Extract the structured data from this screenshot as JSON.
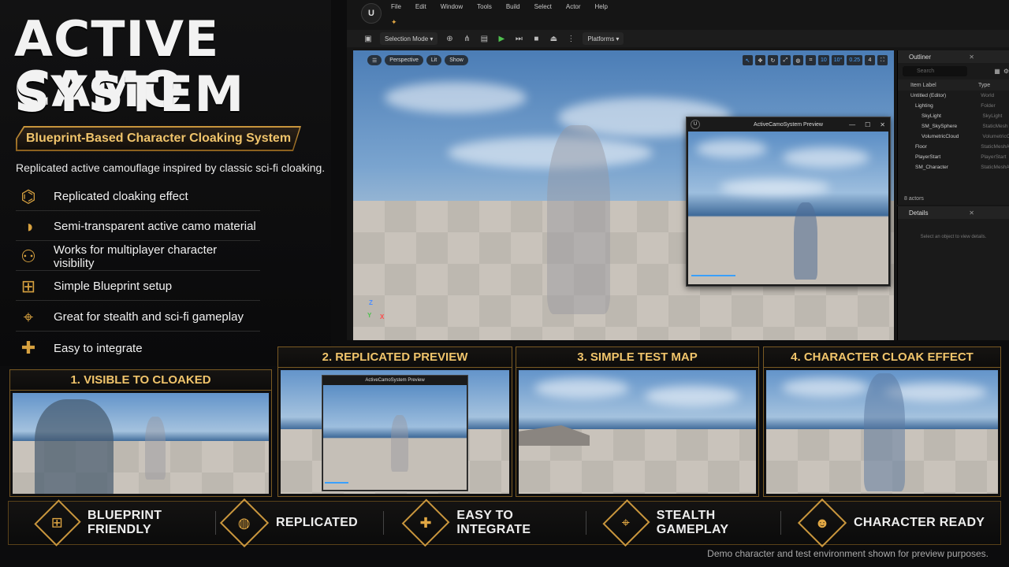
{
  "left": {
    "title_line1": "ACTIVE CAMO",
    "title_line2": "SYSTEM",
    "subtitle": "Blueprint-Based Character Cloaking System",
    "tagline": "Replicated active camouflage inspired by classic sci-fi cloaking.",
    "features": [
      {
        "icon": "network-nodes-icon",
        "glyph": "⌬",
        "label": "Replicated cloaking effect"
      },
      {
        "icon": "half-circle-icon",
        "glyph": "◑",
        "label": "Semi-transparent active camo material"
      },
      {
        "icon": "group-users-icon",
        "glyph": "⚇",
        "label": "Works for multiplayer character visibility"
      },
      {
        "icon": "hierarchy-icon",
        "glyph": "⊞",
        "label": "Simple Blueprint setup"
      },
      {
        "icon": "crosshair-icon",
        "glyph": "⌖",
        "label": "Great for stealth and sci-fi gameplay"
      },
      {
        "icon": "puzzle-icon",
        "glyph": "✚",
        "label": "Easy to integrate"
      }
    ]
  },
  "editor": {
    "menu": [
      "File",
      "Edit",
      "Window",
      "Tools",
      "Build",
      "Select",
      "Actor",
      "Help"
    ],
    "toolbar": {
      "mode": "Selection Mode",
      "platforms": "Platforms"
    },
    "viewport": {
      "perspective": "Perspective",
      "lit": "Lit",
      "show": "Show",
      "grid_snap": "10",
      "rot_snap": "10°",
      "scale_snap": "0.25",
      "cam_speed": "4"
    },
    "preview_title": "ActiveCamoSystem Preview",
    "outliner": {
      "title": "Outliner",
      "search_placeholder": "Search",
      "col_label": "Item Label",
      "col_type": "Type",
      "rows": [
        {
          "name": "Untitled (Editor)",
          "type": "World"
        },
        {
          "name": "Lighting",
          "type": "Folder"
        },
        {
          "name": "SkyLight",
          "type": "SkyLight"
        },
        {
          "name": "SM_SkySphere",
          "type": "StaticMesh"
        },
        {
          "name": "VolumetricCloud",
          "type": "VolumetricClo"
        },
        {
          "name": "Floor",
          "type": "StaticMeshAct"
        },
        {
          "name": "PlayerStart",
          "type": "PlayerStart"
        },
        {
          "name": "SM_Character",
          "type": "StaticMeshAct"
        }
      ],
      "count": "8 actors"
    },
    "details": {
      "title": "Details",
      "hint": "Select an object to view details."
    }
  },
  "cards": [
    {
      "title": "1. VISIBLE TO CLOAKED"
    },
    {
      "title": "2. REPLICATED PREVIEW",
      "inner_title": "ActiveCamoSystem Preview"
    },
    {
      "title": "3. SIMPLE TEST MAP"
    },
    {
      "title": "4. CHARACTER CLOAK EFFECT"
    }
  ],
  "bottom": [
    {
      "icon": "blueprint-icon",
      "glyph": "⊞",
      "label": "BLUEPRINT FRIENDLY"
    },
    {
      "icon": "globe-icon",
      "glyph": "◍",
      "label": "REPLICATED"
    },
    {
      "icon": "puzzle-icon",
      "glyph": "✚",
      "label": "EASY TO INTEGRATE"
    },
    {
      "icon": "crosshair-icon",
      "glyph": "⌖",
      "label": "STEALTH GAMEPLAY"
    },
    {
      "icon": "user-icon",
      "glyph": "☻",
      "label": "CHARACTER READY"
    }
  ],
  "footnote": "Demo character and test environment shown for preview purposes.",
  "colors": {
    "accent": "#d7a13f",
    "accent_dark": "#7a5a23",
    "background": "#0c0c0d"
  }
}
